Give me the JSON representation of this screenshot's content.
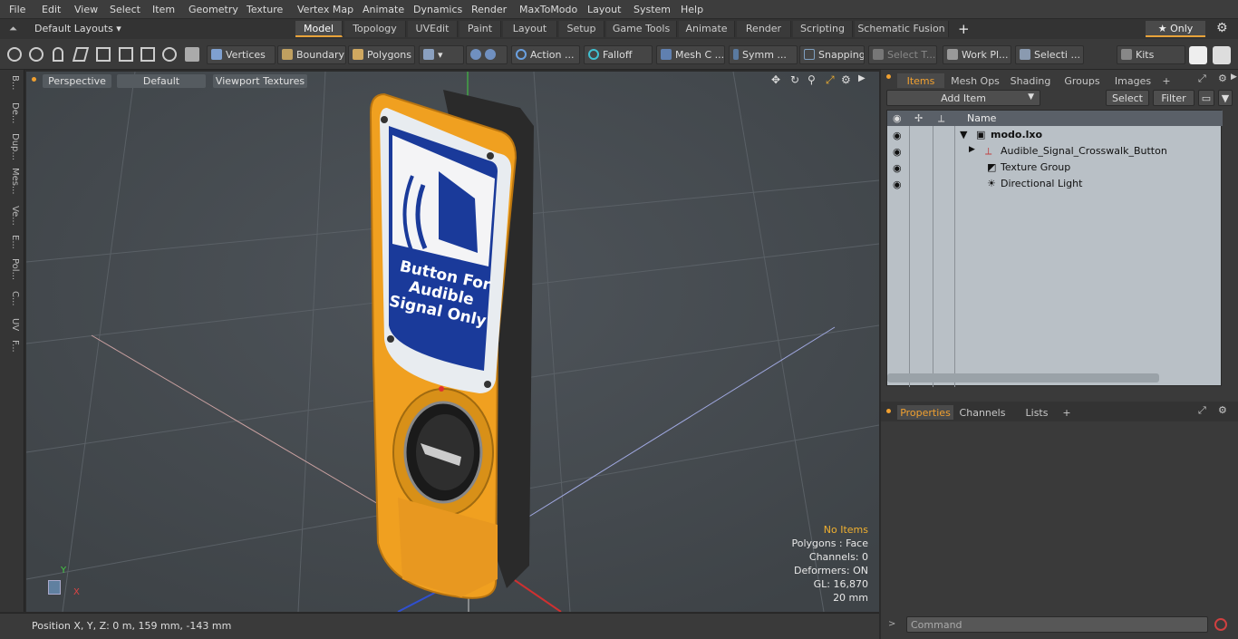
{
  "menubar": {
    "items": [
      "File",
      "Edit",
      "View",
      "Select",
      "Item",
      "Geometry",
      "Texture",
      "Vertex Map",
      "Animate",
      "Dynamics",
      "Render",
      "MaxToModo",
      "Layout",
      "System",
      "Help"
    ]
  },
  "layoutbar": {
    "layout_selector": "Default Layouts ▾",
    "tabs": [
      "Model",
      "Topology",
      "UVEdit",
      "Paint",
      "Layout",
      "Setup",
      "Game Tools",
      "Animate",
      "Render",
      "Scripting",
      "Schematic Fusion"
    ],
    "active_tab": "Model",
    "add_tab": "+",
    "only_label": "★ Only",
    "gear": "⚙"
  },
  "toolbar": {
    "buttons": [
      "Vertices",
      "Boundary",
      "Polygons",
      "Action ...",
      "Falloff",
      "Mesh C ...",
      "Symm ...",
      "Snapping",
      "Select T...",
      "Work Pl...",
      "Selecti ...",
      "Kits"
    ]
  },
  "lefttabs": [
    "B...",
    "De...",
    "Dup...",
    "Mes...",
    "Ve...",
    "E...",
    "Pol...",
    "C...",
    "UV",
    "F..."
  ],
  "viewport": {
    "header": [
      "Perspective",
      "Default",
      "Viewport Textures"
    ],
    "sign_text": [
      "Button For",
      "Audible",
      "Signal Only"
    ],
    "hud": {
      "status": "No Items",
      "polygons": "Polygons : Face",
      "channels": "Channels: 0",
      "deformers": "Deformers: ON",
      "gl": "GL: 16,870",
      "scale": "20 mm"
    },
    "axes": {
      "x": "X",
      "y": "Y"
    }
  },
  "statusbar": {
    "position": "Position X, Y, Z:   0 m, 159 mm, -143 mm"
  },
  "rightpanel": {
    "tabs": [
      "Items",
      "Mesh Ops",
      "Shading",
      "Groups",
      "Images",
      "+"
    ],
    "add_item": "Add Item",
    "select": "Select",
    "filter": "Filter",
    "column_name": "Name",
    "items": [
      {
        "label": "modo.lxo",
        "bold": true
      },
      {
        "label": "Audible_Signal_Crosswalk_Button",
        "bold": false
      },
      {
        "label": "Texture Group",
        "bold": false
      },
      {
        "label": "Directional Light",
        "bold": false
      }
    ],
    "bottom_tabs": [
      "Properties",
      "Channels",
      "Lists",
      "+"
    ],
    "command_placeholder": "Command"
  },
  "colors": {
    "accent": "#f0a030",
    "viewport_bg": "#4a5055",
    "sign_blue": "#1a3a9a",
    "body_orange": "#f0a020"
  }
}
